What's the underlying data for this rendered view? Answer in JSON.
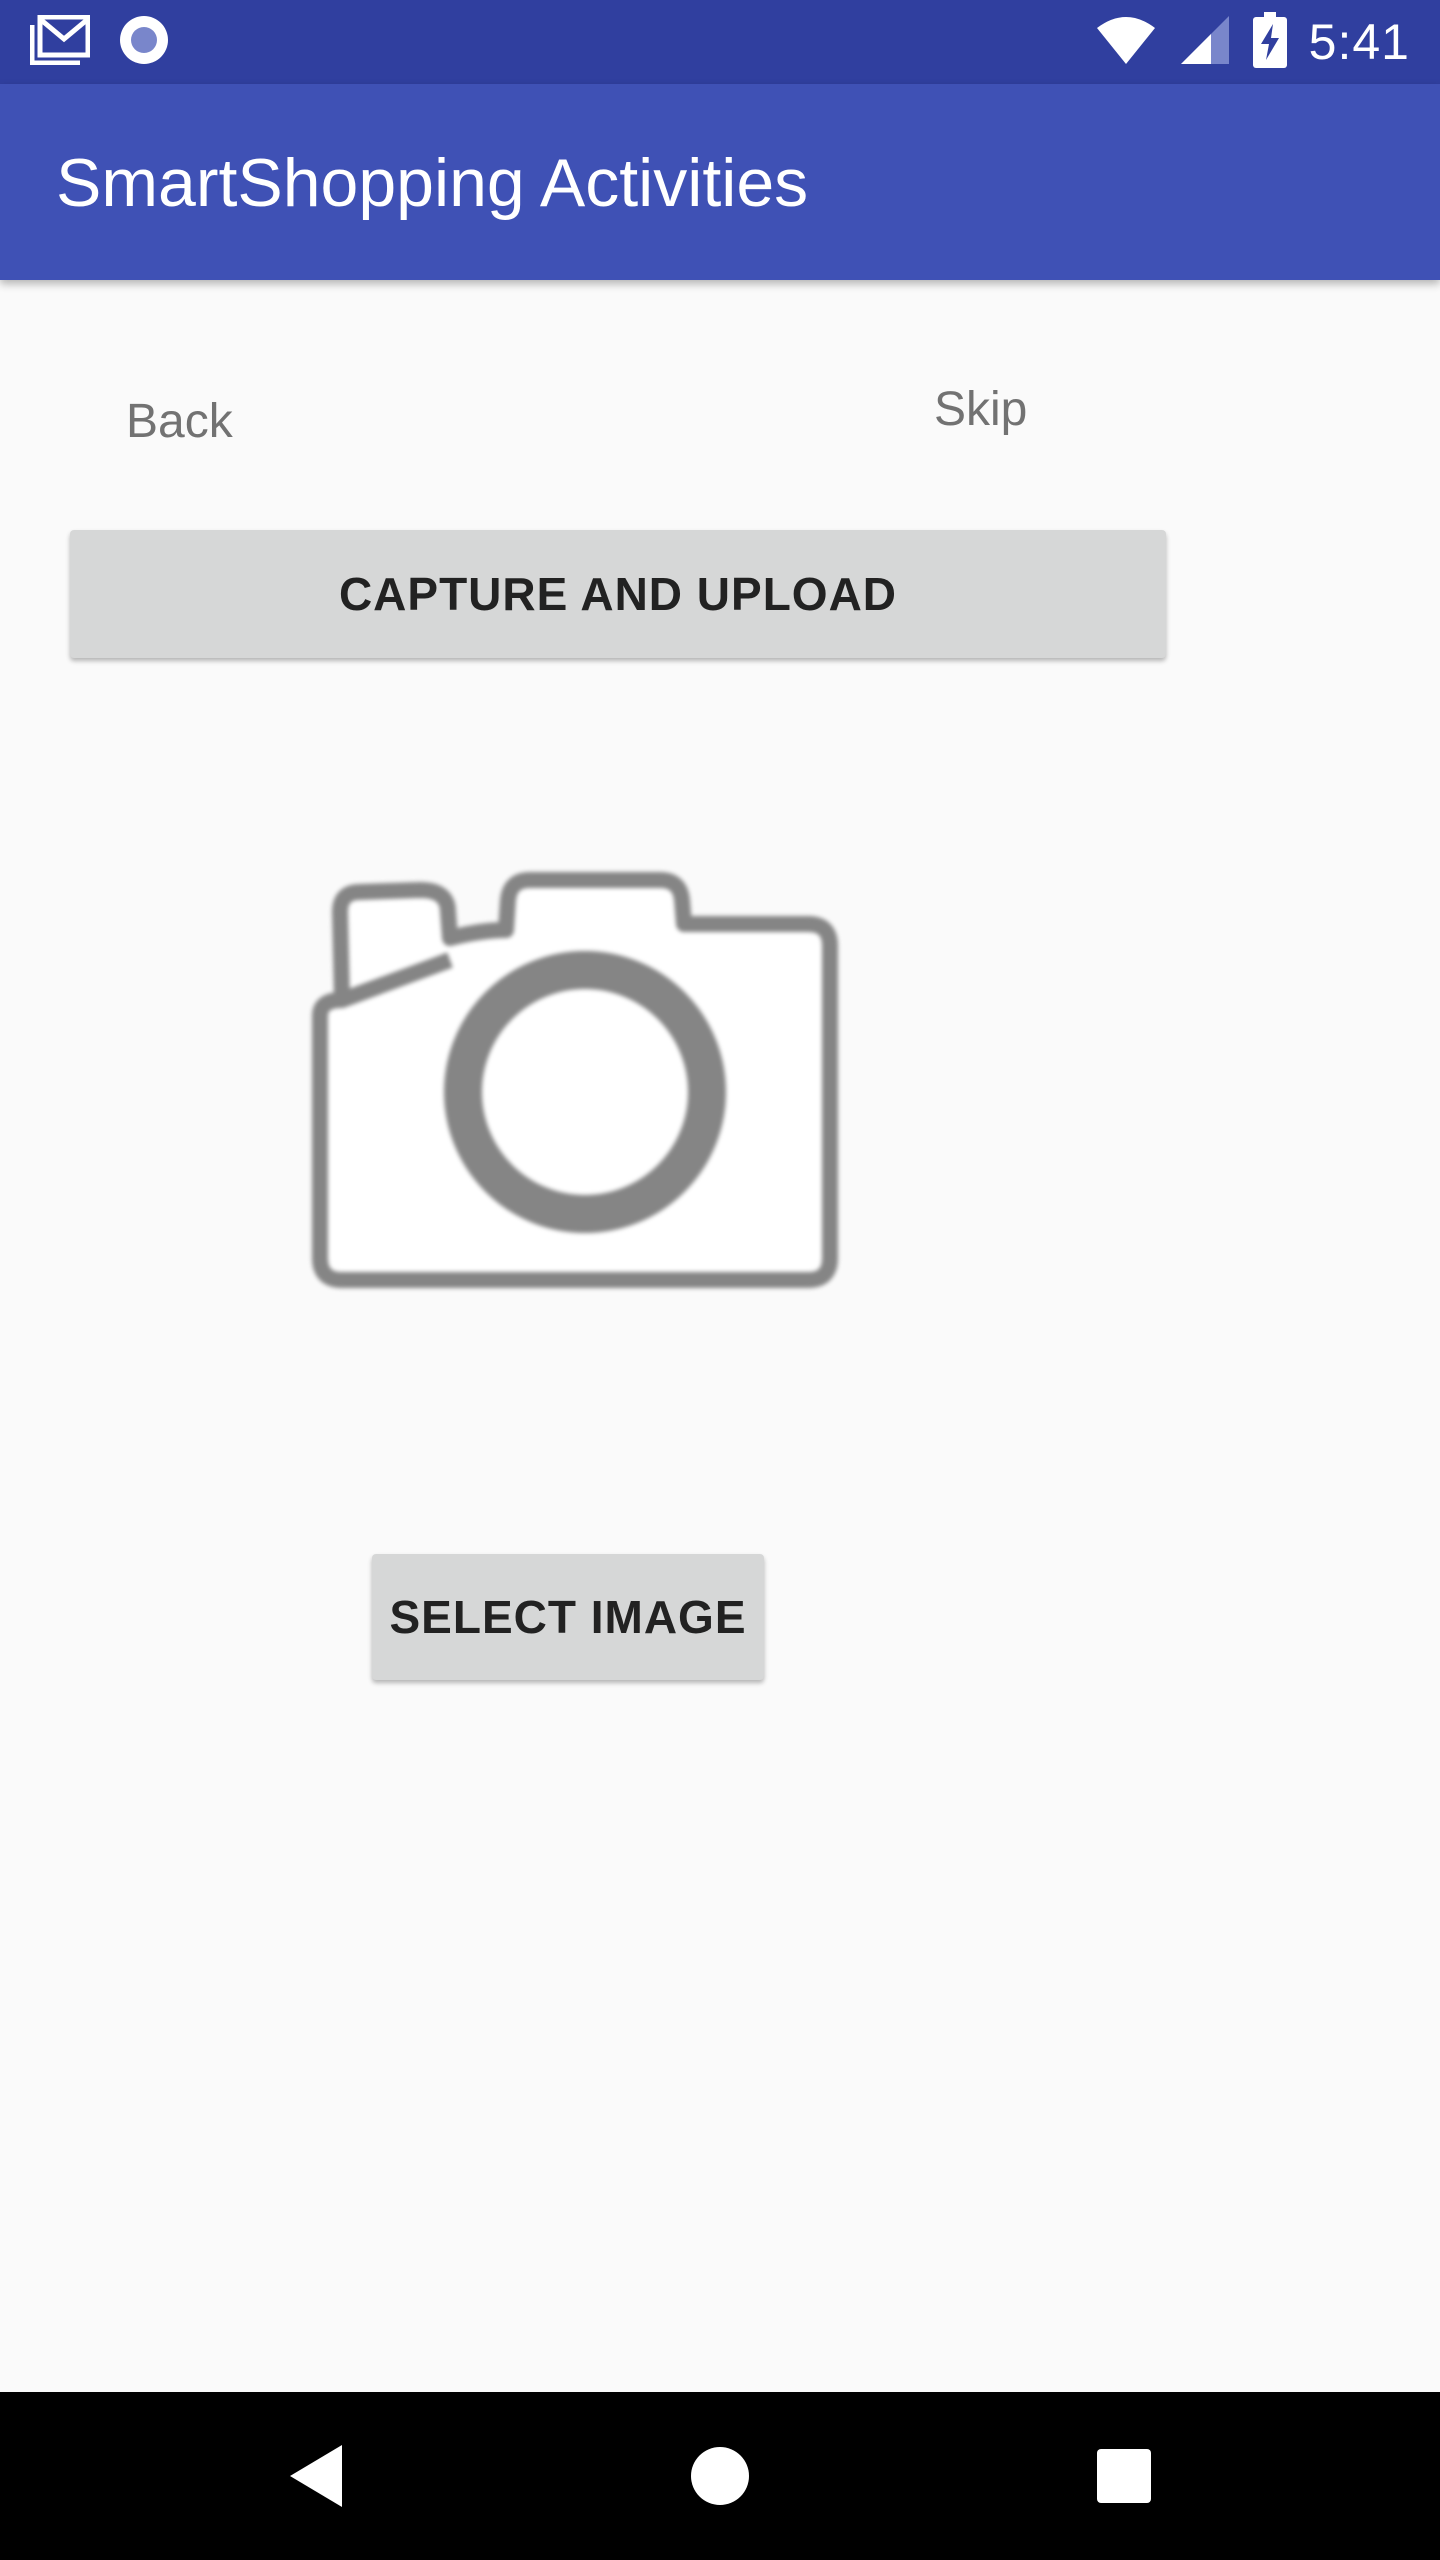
{
  "status_bar": {
    "time": "5:41",
    "icons": [
      "gmail-icon",
      "radio-icon",
      "wifi-icon",
      "cell-signal-icon",
      "battery-charging-icon"
    ]
  },
  "app_bar": {
    "title": "SmartShopping Activities",
    "color": "#3f51b5"
  },
  "nav": {
    "back_label": "Back",
    "skip_label": "Skip"
  },
  "actions": {
    "capture_label": "CAPTURE AND UPLOAD",
    "select_label": "SELECT IMAGE"
  },
  "image_placeholder": {
    "icon": "camera-icon"
  },
  "system_nav": {
    "icons": [
      "back-triangle-icon",
      "home-circle-icon",
      "recents-square-icon"
    ]
  },
  "colors": {
    "status_bar": "#303f9f",
    "app_bar": "#3f51b5",
    "background": "#fafafa",
    "button": "#d6d7d7"
  }
}
